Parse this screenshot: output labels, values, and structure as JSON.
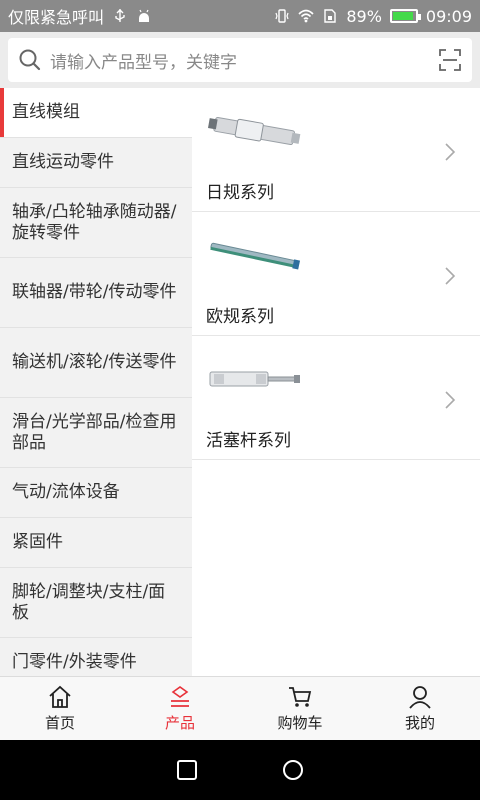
{
  "status_bar": {
    "left_text": "仅限紧急呼叫",
    "battery_percent": "89%",
    "battery_level": 0.89,
    "time": "09:09"
  },
  "search": {
    "placeholder": "请输入产品型号，关键字",
    "search_icon": "search-icon",
    "scan_icon": "scan-icon"
  },
  "sidebar": {
    "items": [
      {
        "label": "直线模组",
        "active": true
      },
      {
        "label": "直线运动零件"
      },
      {
        "label": "轴承/凸轮轴承随动器/旋转零件"
      },
      {
        "label": "联轴器/带轮/传动零件"
      },
      {
        "label": "输送机/滚轮/传送零件"
      },
      {
        "label": "滑台/光学部品/检查用部品"
      },
      {
        "label": "气动/流体设备"
      },
      {
        "label": "紧固件"
      },
      {
        "label": "脚轮/调整块/支柱/面板"
      },
      {
        "label": "门零件/外装零件"
      }
    ]
  },
  "products": [
    {
      "name": "日规系列",
      "icon": "linear-module-image"
    },
    {
      "name": "欧规系列",
      "icon": "linear-rail-image"
    },
    {
      "name": "活塞杆系列",
      "icon": "piston-rod-image"
    }
  ],
  "tabbar": {
    "items": [
      {
        "label": "首页",
        "icon": "home-icon"
      },
      {
        "label": "产品",
        "icon": "product-icon",
        "active": true
      },
      {
        "label": "购物车",
        "icon": "cart-icon"
      },
      {
        "label": "我的",
        "icon": "user-icon"
      }
    ]
  },
  "colors": {
    "accent": "#e8323a",
    "status_bar": "#8a8a8a",
    "sidebar_bg": "#f2f2f2"
  }
}
